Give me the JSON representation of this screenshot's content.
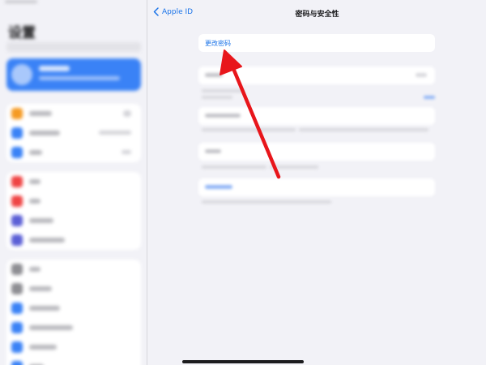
{
  "sidebar": {
    "title": "设置",
    "groups": [
      {
        "rows": [
          {
            "icon_color": "#f59a23"
          },
          {
            "icon_color": "#3a82f6"
          },
          {
            "icon_color": "#3a82f6"
          }
        ]
      },
      {
        "rows": [
          {
            "icon_color": "#ef4444"
          },
          {
            "icon_color": "#ef4444"
          },
          {
            "icon_color": "#5b5fd6"
          },
          {
            "icon_color": "#5b5fd6"
          }
        ]
      },
      {
        "rows": [
          {
            "icon_color": "#8e8e93"
          },
          {
            "icon_color": "#8e8e93"
          },
          {
            "icon_color": "#3a82f6"
          },
          {
            "icon_color": "#3a82f6"
          },
          {
            "icon_color": "#3a82f6"
          },
          {
            "icon_color": "#3a82f6"
          }
        ]
      }
    ]
  },
  "nav": {
    "back_label": "Apple ID",
    "title": "密码与安全性"
  },
  "main": {
    "change_password_label": "更改密码"
  },
  "colors": {
    "accent": "#1a73e8",
    "annotation_arrow": "#e8161b"
  }
}
